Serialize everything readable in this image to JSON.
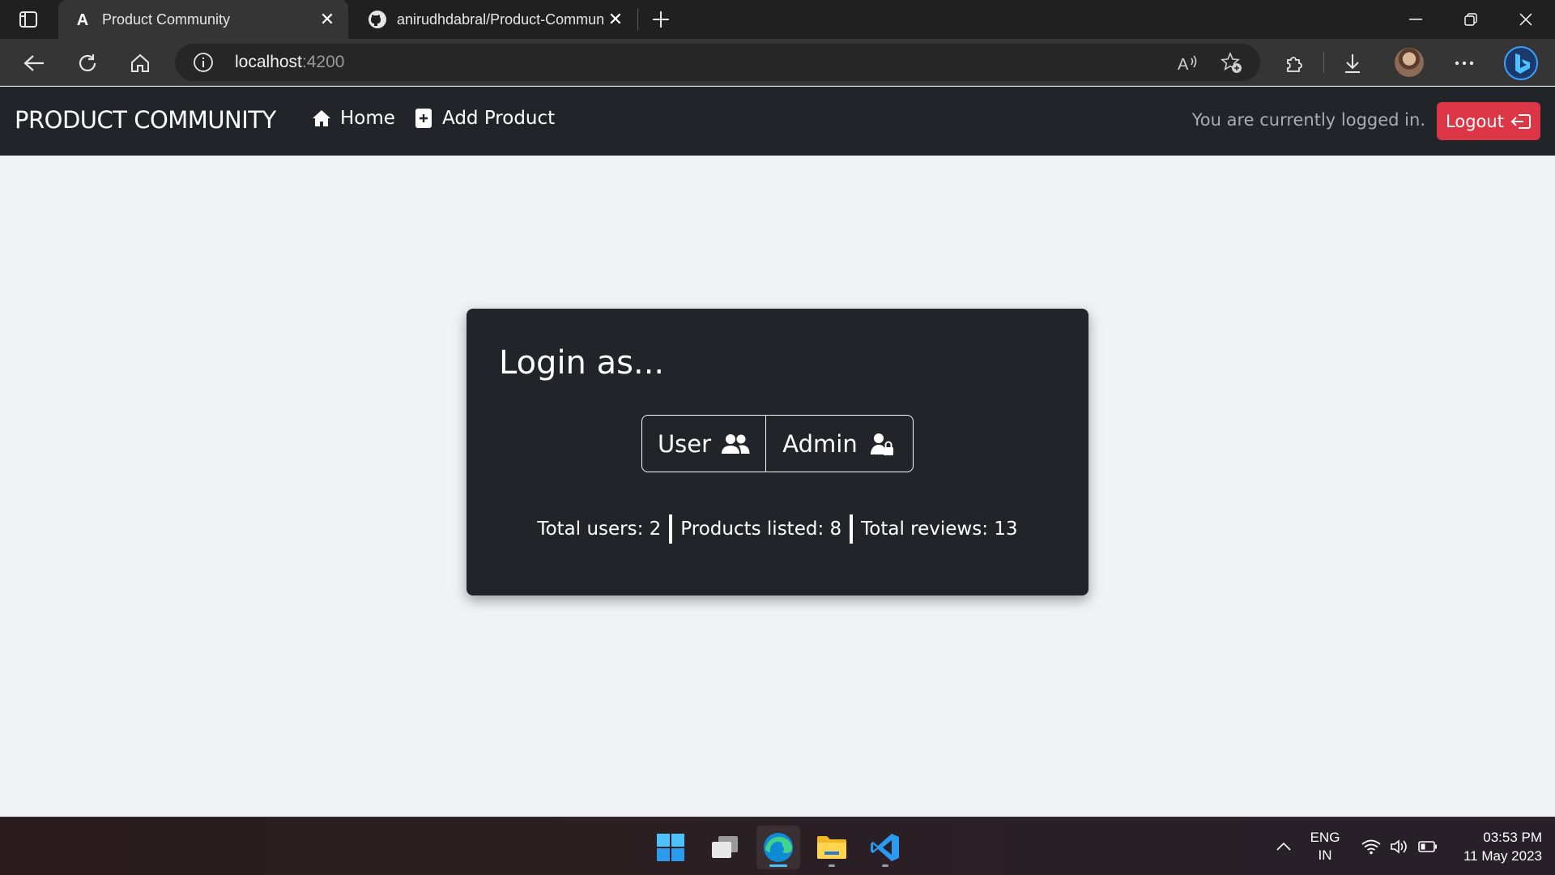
{
  "browser": {
    "tabs": [
      {
        "title": "Product Community",
        "active": true,
        "icon": "angular-icon"
      },
      {
        "title": "anirudhdabral/Product-Community",
        "active": false,
        "icon": "github-icon"
      }
    ],
    "address": {
      "host": "localhost",
      "port": ":4200"
    }
  },
  "app": {
    "brand": "PRODUCT COMMUNITY",
    "nav": {
      "home": "Home",
      "add_product": "Add Product"
    },
    "status_text": "You are currently logged in.",
    "logout_label": "Logout",
    "colors": {
      "navbar": "#212529",
      "logout": "#dc3545",
      "page_bg": "#f0f2f5"
    }
  },
  "login_card": {
    "title": "Login as...",
    "user_label": "User",
    "admin_label": "Admin",
    "stats": {
      "users": "Total users: 2",
      "products": "Products listed: 8",
      "reviews": "Total reviews: 13"
    }
  },
  "taskbar": {
    "apps": [
      "start-icon",
      "task-view-icon",
      "edge-icon",
      "file-explorer-icon",
      "vscode-icon"
    ],
    "lang_line1": "ENG",
    "lang_line2": "IN",
    "time": "03:53 PM",
    "date": "11 May 2023"
  }
}
